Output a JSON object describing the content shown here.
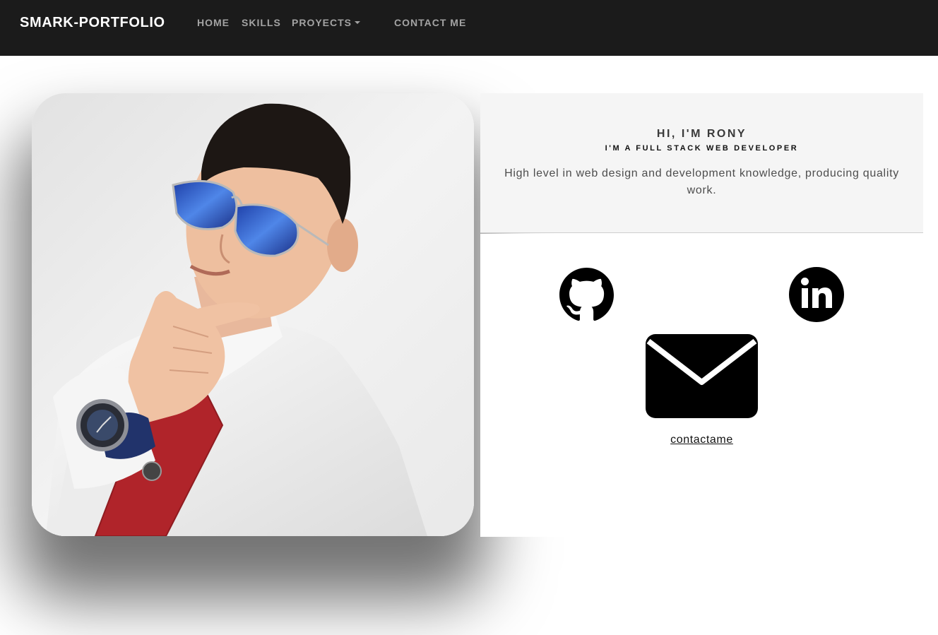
{
  "navbar": {
    "brand": "SMARK-PORTFOLIO",
    "links": {
      "home": "HOME",
      "skills": "SKILLS",
      "proyects": "PROYECTS",
      "contact": "CONTACT ME"
    },
    "background": "#1b1b1b",
    "link_color": "#a3a3a3"
  },
  "profile": {
    "photo_icon": "profile-photo"
  },
  "intro": {
    "greeting": "HI, I'M RONY",
    "subtitle": "I'M A FULL STACK WEB DEVELOPER",
    "description": "High level in web design and development knowledge, producing quality work."
  },
  "social": {
    "github_icon": "github-icon",
    "linkedin_icon": "linkedin-icon",
    "mail_icon": "mail-icon",
    "contact_link": "contactame"
  }
}
